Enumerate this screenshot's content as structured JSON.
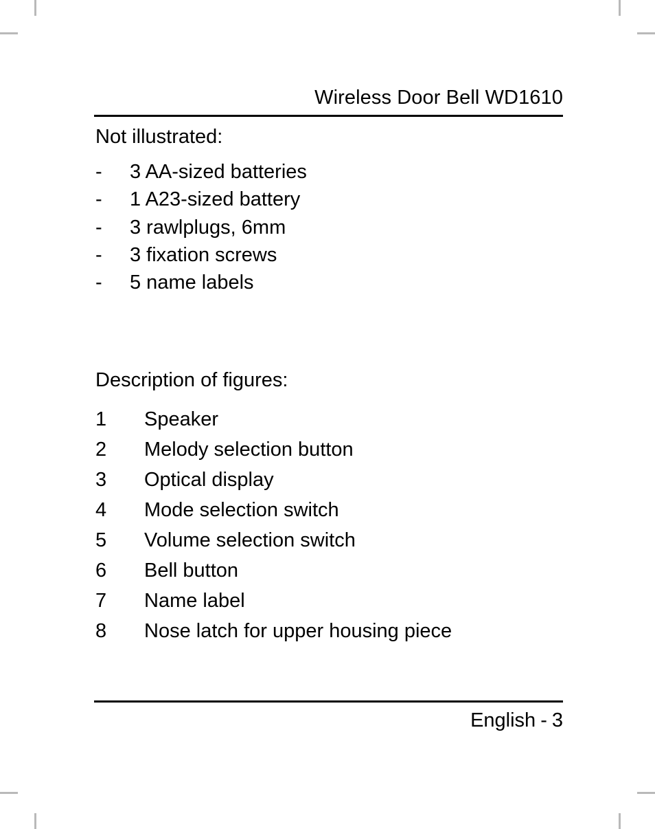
{
  "header": {
    "title": "Wireless Door Bell WD1610"
  },
  "sections": {
    "not_illustrated": {
      "heading": "Not illustrated:",
      "items": [
        {
          "marker": "-",
          "text": "3 AA-sized batteries"
        },
        {
          "marker": "-",
          "text": "1 A23-sized battery"
        },
        {
          "marker": "-",
          "text": "3 rawlplugs, 6mm"
        },
        {
          "marker": "-",
          "text": "3 fixation screws"
        },
        {
          "marker": "-",
          "text": "5 name labels"
        }
      ]
    },
    "description_of_figures": {
      "heading": "Description of figures:",
      "items": [
        {
          "marker": "1",
          "text": "Speaker"
        },
        {
          "marker": "2",
          "text": "Melody selection button"
        },
        {
          "marker": "3",
          "text": "Optical display"
        },
        {
          "marker": "4",
          "text": "Mode selection switch"
        },
        {
          "marker": "5",
          "text": "Volume selection switch"
        },
        {
          "marker": "6",
          "text": "Bell button"
        },
        {
          "marker": "7",
          "text": "Name label"
        },
        {
          "marker": "8",
          "text": "Nose latch for upper housing piece"
        }
      ]
    }
  },
  "footer": {
    "language": "English",
    "separator": "-",
    "page_number": "3"
  }
}
